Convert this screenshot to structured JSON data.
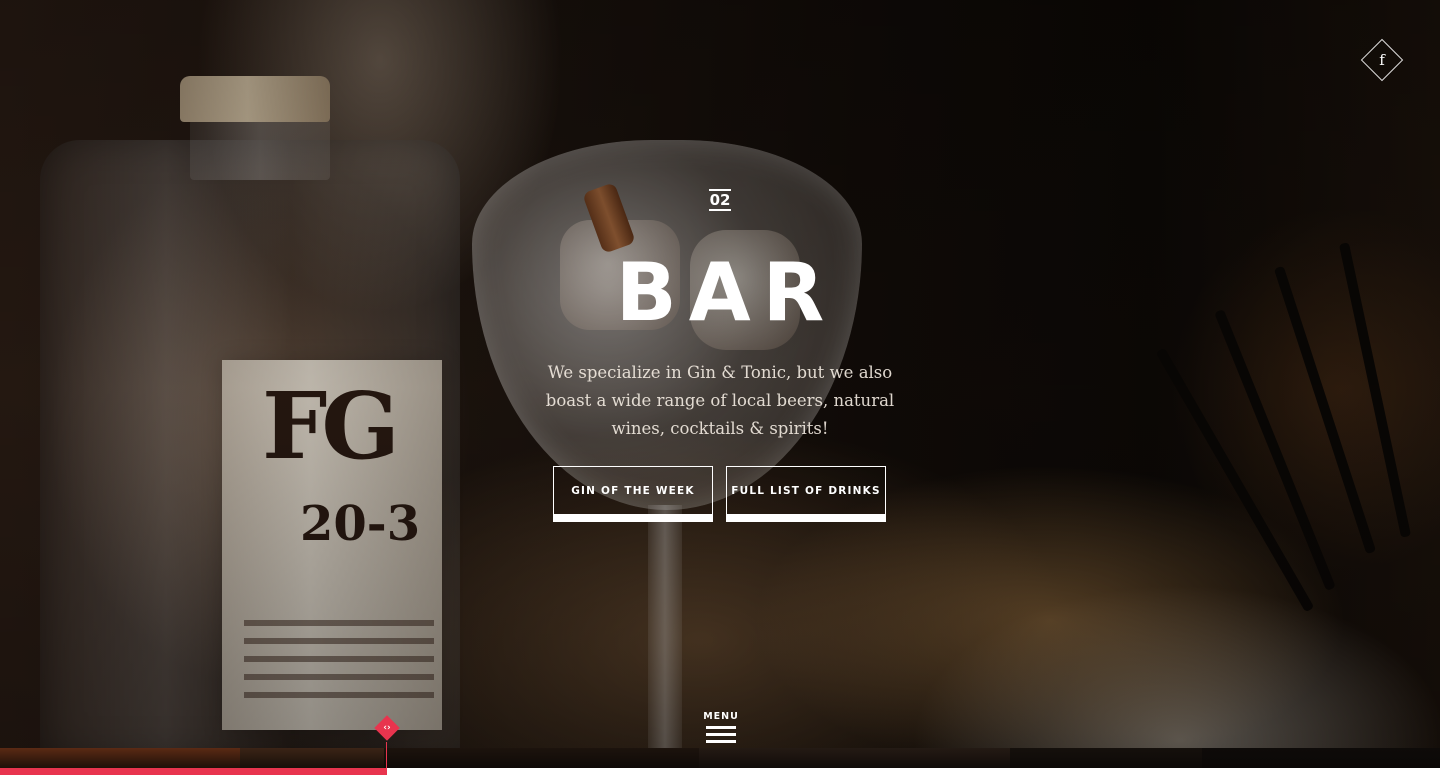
{
  "social": {
    "facebook_icon": "facebook-icon",
    "facebook_letter": "f"
  },
  "section": {
    "number": "02",
    "title": "BAR",
    "description": "We specialize in Gin & Tonic, but we also boast a wide range of local beers, natural wines, cocktails & spirits!"
  },
  "buttons": {
    "gin_of_the_week": "GIN OF THE WEEK",
    "full_list": "FULL LIST OF DRINKS"
  },
  "menu": {
    "label": "MENU",
    "icon": "hamburger-icon"
  },
  "timeline": {
    "progress": 0.269,
    "accent_color": "#e8344e",
    "handle_icon": "drag-handle-icon",
    "handle_glyph": "‹›",
    "thumbnails": [
      {
        "name": "thumb-1",
        "color": "#5a2a14",
        "width_fraction": 0.167
      },
      {
        "name": "thumb-2",
        "color": "#3b2416",
        "width_fraction": 0.1
      },
      {
        "name": "thumb-3",
        "color": "#1c130d",
        "width_fraction": 0.219
      },
      {
        "name": "thumb-4",
        "color": "#241a14",
        "width_fraction": 0.216
      },
      {
        "name": "thumb-5",
        "color": "#15100c",
        "width_fraction": 0.133
      },
      {
        "name": "thumb-6",
        "color": "#0e0b09",
        "width_fraction": 0.165
      }
    ]
  },
  "background": {
    "bottle_label_letters": "FG",
    "bottle_label_number": "20-3"
  }
}
